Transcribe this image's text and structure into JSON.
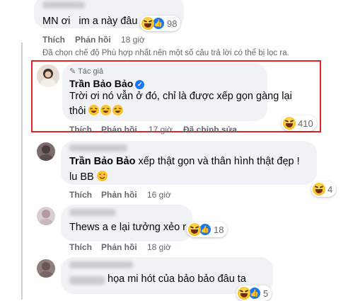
{
  "comments": [
    {
      "text": "MN ơi   im a này đâu",
      "reaction_count": "98",
      "actions": {
        "like": "Thích",
        "reply": "Phản hồi",
        "time": "18 giờ"
      }
    },
    {
      "author": "Trần Bảo Bảo",
      "author_badge": "Tác giả",
      "line1": "Trời ơi nó vẫn ở đó, chỉ là được xếp gọn gàng lại",
      "line2": "thôi",
      "reaction_count": "410",
      "actions": {
        "like": "Thích",
        "reply": "Phản hồi",
        "time": "17 giờ",
        "edited": "Đã chỉnh sửa"
      }
    },
    {
      "text_author": "Trần Bảo Bảo",
      "text_rest": " xếp thật gọn và thân hình thật đẹp !",
      "line2": "lu BB",
      "reaction_count": "4",
      "actions": {
        "like": "Thích",
        "reply": "Phản hồi",
        "time": "16 giờ"
      }
    },
    {
      "text": "Thews a e lại tưởng xẻo r",
      "reaction_count": "18",
      "actions": {
        "like": "Thích",
        "reply": "Phản hồi",
        "time": "18 giờ"
      }
    },
    {
      "text": "họa mi hót của bảo bảo đâu ta",
      "reaction_count": "5"
    }
  ],
  "filter_notice": "Đã chọn chế độ Phù hợp nhất nên một số câu trả lời có thể bị lọc ra.",
  "colors": {
    "highlight_border": "#e02424",
    "link_blue": "#1877f2",
    "meta_gray": "#65676b"
  }
}
